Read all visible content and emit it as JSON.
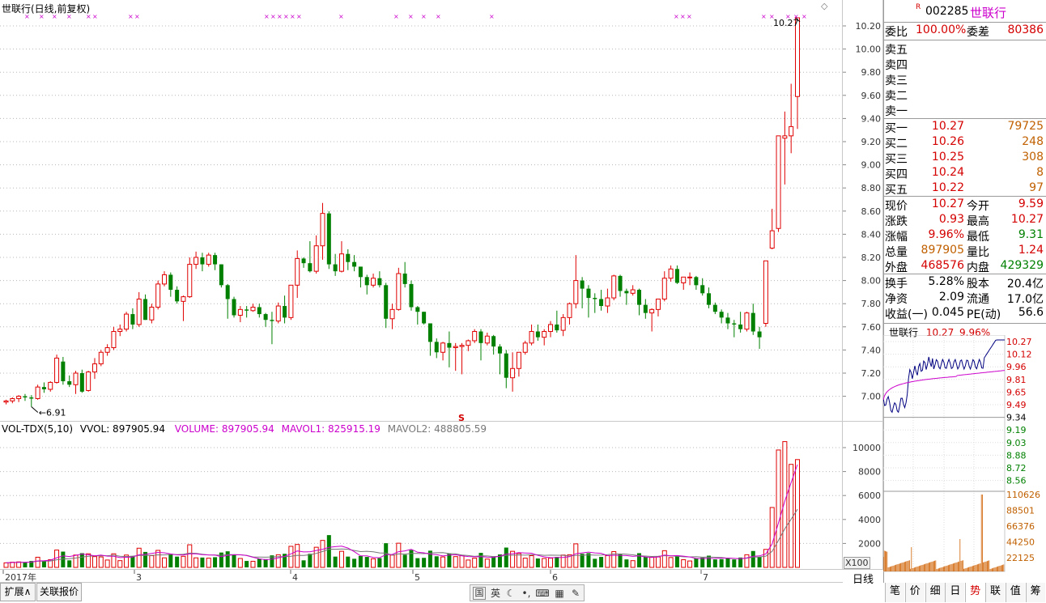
{
  "main_chart": {
    "title": "世联行(日线,前复权)",
    "x_labels": [
      "2017年",
      "3",
      "4",
      "5",
      "6",
      "7"
    ],
    "high_label": "10.27",
    "low_label": "6.91",
    "marker_label": "S",
    "corner_glyph": "◇"
  },
  "chart_data": [
    {
      "type": "candlestick",
      "title": "世联行(日线,前复权)",
      "y_ticks": [
        "10.20",
        "10.00",
        "9.80",
        "9.60",
        "9.40",
        "9.20",
        "9.00",
        "8.80",
        "8.60",
        "8.40",
        "8.20",
        "8.00",
        "7.80",
        "7.60",
        "7.40",
        "7.20",
        "7.00"
      ],
      "ylim": [
        6.8,
        10.3
      ],
      "candles": [
        [
          6.95,
          6.97,
          6.93,
          6.96
        ],
        [
          6.96,
          6.99,
          6.94,
          6.98
        ],
        [
          6.98,
          7.01,
          6.95,
          7.0
        ],
        [
          7.0,
          7.02,
          6.96,
          6.99
        ],
        [
          6.99,
          7.01,
          6.91,
          6.98
        ],
        [
          6.98,
          7.1,
          6.97,
          7.08
        ],
        [
          7.08,
          7.12,
          7.03,
          7.06
        ],
        [
          7.06,
          7.13,
          7.04,
          7.12
        ],
        [
          7.12,
          7.36,
          7.11,
          7.33
        ],
        [
          7.3,
          7.34,
          7.1,
          7.13
        ],
        [
          7.13,
          7.18,
          7.08,
          7.1
        ],
        [
          7.1,
          7.22,
          7.02,
          7.2
        ],
        [
          7.2,
          7.23,
          7.03,
          7.04
        ],
        [
          7.05,
          7.22,
          7.04,
          7.21
        ],
        [
          7.21,
          7.33,
          7.15,
          7.28
        ],
        [
          7.28,
          7.4,
          7.26,
          7.38
        ],
        [
          7.38,
          7.45,
          7.35,
          7.42
        ],
        [
          7.42,
          7.6,
          7.4,
          7.56
        ],
        [
          7.56,
          7.62,
          7.52,
          7.58
        ],
        [
          7.58,
          7.73,
          7.56,
          7.71
        ],
        [
          7.71,
          7.76,
          7.58,
          7.62
        ],
        [
          7.62,
          7.9,
          7.6,
          7.84
        ],
        [
          7.84,
          7.88,
          7.66,
          7.66
        ],
        [
          7.66,
          7.8,
          7.63,
          7.77
        ],
        [
          7.77,
          8.0,
          7.75,
          7.97
        ],
        [
          7.97,
          8.08,
          7.95,
          8.05
        ],
        [
          8.05,
          8.07,
          7.86,
          7.92
        ],
        [
          7.92,
          7.95,
          7.8,
          7.82
        ],
        [
          7.82,
          7.87,
          7.65,
          7.86
        ],
        [
          7.86,
          8.2,
          7.85,
          8.14
        ],
        [
          8.14,
          8.25,
          8.1,
          8.2
        ],
        [
          8.2,
          8.24,
          8.08,
          8.14
        ],
        [
          8.14,
          8.24,
          8.12,
          8.22
        ],
        [
          8.22,
          8.24,
          8.09,
          8.14
        ],
        [
          8.14,
          8.14,
          7.94,
          7.96
        ],
        [
          7.96,
          7.97,
          7.67,
          7.84
        ],
        [
          7.84,
          7.86,
          7.68,
          7.7
        ],
        [
          7.7,
          7.78,
          7.64,
          7.75
        ],
        [
          7.75,
          7.78,
          7.68,
          7.74
        ],
        [
          7.74,
          7.8,
          7.73,
          7.77
        ],
        [
          7.77,
          7.8,
          7.68,
          7.71
        ],
        [
          7.71,
          7.72,
          7.6,
          7.66
        ],
        [
          7.66,
          7.73,
          7.45,
          7.65
        ],
        [
          7.65,
          7.81,
          7.63,
          7.78
        ],
        [
          7.78,
          7.87,
          7.63,
          7.68
        ],
        [
          7.68,
          7.96,
          7.66,
          7.96
        ],
        [
          7.96,
          8.26,
          7.85,
          8.19
        ],
        [
          8.19,
          8.2,
          8.11,
          8.15
        ],
        [
          8.15,
          8.34,
          8.07,
          8.08
        ],
        [
          8.08,
          8.39,
          8.06,
          8.3
        ],
        [
          8.3,
          8.67,
          8.18,
          8.58
        ],
        [
          8.58,
          8.6,
          8.1,
          8.14
        ],
        [
          8.14,
          8.23,
          8.04,
          8.08
        ],
        [
          8.08,
          8.34,
          8.07,
          8.23
        ],
        [
          8.23,
          8.27,
          8.09,
          8.16
        ],
        [
          8.16,
          8.22,
          8.08,
          8.12
        ],
        [
          8.12,
          8.12,
          7.94,
          8.03
        ],
        [
          8.03,
          8.05,
          7.88,
          7.96
        ],
        [
          7.96,
          8.06,
          7.94,
          8.02
        ],
        [
          8.02,
          8.08,
          7.94,
          7.96
        ],
        [
          7.96,
          7.98,
          7.59,
          7.67
        ],
        [
          7.67,
          7.8,
          7.58,
          7.75
        ],
        [
          7.75,
          8.11,
          7.74,
          8.06
        ],
        [
          8.06,
          8.16,
          7.94,
          7.97
        ],
        [
          7.97,
          8.0,
          7.74,
          7.77
        ],
        [
          7.77,
          7.78,
          7.62,
          7.73
        ],
        [
          7.73,
          7.73,
          7.62,
          7.63
        ],
        [
          7.63,
          7.63,
          7.35,
          7.47
        ],
        [
          7.47,
          7.5,
          7.33,
          7.38
        ],
        [
          7.38,
          7.47,
          7.31,
          7.46
        ],
        [
          7.46,
          7.56,
          7.25,
          7.42
        ],
        [
          7.42,
          7.46,
          7.22,
          7.43
        ],
        [
          7.43,
          7.46,
          7.19,
          7.44
        ],
        [
          7.44,
          7.49,
          7.39,
          7.48
        ],
        [
          7.48,
          7.58,
          7.46,
          7.56
        ],
        [
          7.56,
          7.58,
          7.31,
          7.46
        ],
        [
          7.46,
          7.55,
          7.44,
          7.52
        ],
        [
          7.52,
          7.53,
          7.36,
          7.43
        ],
        [
          7.43,
          7.45,
          7.19,
          7.37
        ],
        [
          7.37,
          7.4,
          7.07,
          7.16
        ],
        [
          7.16,
          7.38,
          7.04,
          7.24
        ],
        [
          7.24,
          7.38,
          7.17,
          7.38
        ],
        [
          7.38,
          7.48,
          7.36,
          7.46
        ],
        [
          7.46,
          7.62,
          7.44,
          7.56
        ],
        [
          7.56,
          7.62,
          7.48,
          7.51
        ],
        [
          7.51,
          7.58,
          7.44,
          7.56
        ],
        [
          7.56,
          7.65,
          7.51,
          7.62
        ],
        [
          7.62,
          7.74,
          7.55,
          7.57
        ],
        [
          7.57,
          7.71,
          7.52,
          7.68
        ],
        [
          7.68,
          7.81,
          7.62,
          7.8
        ],
        [
          7.8,
          8.22,
          7.76,
          8.0
        ],
        [
          8.0,
          8.03,
          7.76,
          7.93
        ],
        [
          7.93,
          7.96,
          7.68,
          7.85
        ],
        [
          7.85,
          7.89,
          7.72,
          7.84
        ],
        [
          7.84,
          7.92,
          7.74,
          7.78
        ],
        [
          7.78,
          7.93,
          7.72,
          7.85
        ],
        [
          7.85,
          8.05,
          7.83,
          8.04
        ],
        [
          8.04,
          8.05,
          7.86,
          7.91
        ],
        [
          7.91,
          7.93,
          7.79,
          7.89
        ],
        [
          7.89,
          7.96,
          7.87,
          7.92
        ],
        [
          7.92,
          7.93,
          7.7,
          7.79
        ],
        [
          7.79,
          7.84,
          7.67,
          7.72
        ],
        [
          7.72,
          7.76,
          7.56,
          7.75
        ],
        [
          7.75,
          7.84,
          7.69,
          7.84
        ],
        [
          7.84,
          8.08,
          7.82,
          8.02
        ],
        [
          8.02,
          8.13,
          7.99,
          8.1
        ],
        [
          8.1,
          8.13,
          7.97,
          7.98
        ],
        [
          7.98,
          8.02,
          7.92,
          8.03
        ],
        [
          8.03,
          8.07,
          7.96,
          8.03
        ],
        [
          8.03,
          8.04,
          7.92,
          7.96
        ],
        [
          7.96,
          8.02,
          7.87,
          7.89
        ],
        [
          7.89,
          7.94,
          7.76,
          7.79
        ],
        [
          7.79,
          7.81,
          7.71,
          7.73
        ],
        [
          7.73,
          7.75,
          7.63,
          7.68
        ],
        [
          7.68,
          7.72,
          7.58,
          7.63
        ],
        [
          7.63,
          7.66,
          7.51,
          7.62
        ],
        [
          7.62,
          7.73,
          7.55,
          7.58
        ],
        [
          7.58,
          7.73,
          7.56,
          7.72
        ],
        [
          7.72,
          7.8,
          7.53,
          7.56
        ],
        [
          7.56,
          7.6,
          7.41,
          7.51
        ],
        [
          7.63,
          8.17,
          7.6,
          8.17
        ],
        [
          8.28,
          8.62,
          8.27,
          8.43
        ],
        [
          8.45,
          8.85,
          8.42,
          9.25
        ],
        [
          9.23,
          9.46,
          8.83,
          9.25
        ],
        [
          9.25,
          9.7,
          9.1,
          9.33
        ],
        [
          9.59,
          10.27,
          9.31,
          10.27
        ]
      ]
    },
    {
      "type": "bar",
      "title": "VOL-TDX(5,10)",
      "y_ticks": [
        "10000",
        "8000",
        "6000",
        "4000",
        "2000"
      ],
      "ylim": [
        0,
        10800
      ],
      "series_labels": {
        "vvol": "VVOL: 897905.94",
        "volume": "VOLUME: 897905.94",
        "mavol1": "MAVOL1: 825915.19",
        "mavol2": "MAVOL2: 488805.59"
      },
      "multiplier": "X100"
    }
  ],
  "quote_panel": {
    "code": "002285",
    "name": "世联行",
    "r_badge": "R",
    "weibi_label": "委比",
    "weibi_value": "100.00%",
    "weicha_label": "委差",
    "weicha_value": "80386",
    "asks": [
      {
        "label": "卖五"
      },
      {
        "label": "卖四"
      },
      {
        "label": "卖三"
      },
      {
        "label": "卖二"
      },
      {
        "label": "卖一"
      }
    ],
    "bids": [
      {
        "label": "买一",
        "price": "10.27",
        "vol": "79725"
      },
      {
        "label": "买二",
        "price": "10.26",
        "vol": "248"
      },
      {
        "label": "买三",
        "price": "10.25",
        "vol": "308"
      },
      {
        "label": "买四",
        "price": "10.24",
        "vol": "8"
      },
      {
        "label": "买五",
        "price": "10.22",
        "vol": "97"
      }
    ],
    "stats": [
      {
        "l1": "现价",
        "v1": "10.27",
        "l2": "今开",
        "v2": "9.59"
      },
      {
        "l1": "涨跌",
        "v1": "0.93",
        "l2": "最高",
        "v2": "10.27"
      },
      {
        "l1": "涨幅",
        "v1": "9.96%",
        "l2": "最低",
        "v2": "9.31"
      },
      {
        "l1": "总量",
        "v1": "897905",
        "l2": "量比",
        "v2": "1.24"
      },
      {
        "l1": "外盘",
        "v1": "468576",
        "l2": "内盘",
        "v2": "429329"
      }
    ],
    "fund": [
      {
        "l1": "换手",
        "v1": "5.28%",
        "l2": "股本",
        "v2": "20.4亿"
      },
      {
        "l1": "净资",
        "v1": "2.09",
        "l2": "流通",
        "v2": "17.0亿"
      },
      {
        "l1": "收益(一)",
        "v1": "0.045",
        "l2": "PE(动)",
        "v2": "56.6"
      }
    ]
  },
  "mini_chart": {
    "name": "世联行",
    "price": "10.27",
    "pct": "9.96%",
    "price_ticks_red": [
      "10.27",
      "10.12",
      "9.96",
      "9.81",
      "9.65",
      "9.49"
    ],
    "price_mid": "9.34",
    "price_ticks_green": [
      "9.19",
      "9.03",
      "8.88",
      "8.72",
      "8.56"
    ],
    "vol_ticks": [
      "110626",
      "88501",
      "66376",
      "44250",
      "22125"
    ]
  },
  "bottom_left_tabs": [
    "扩展∧",
    "关联报价"
  ],
  "center_toolbar": {
    "ime": "英",
    "buttons": [
      "国"
    ]
  },
  "period_label": "日线",
  "right_tabs": [
    "笔",
    "价",
    "细",
    "日",
    "势",
    "联",
    "值",
    "筹"
  ]
}
